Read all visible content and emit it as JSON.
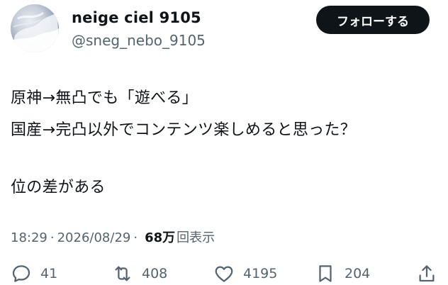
{
  "user": {
    "name": "neige ciel 9105",
    "handle": "@sneg_nebo_9105"
  },
  "follow_button": {
    "label": "フォローする"
  },
  "tweet": {
    "line1": "原神→無凸でも「遊べる」",
    "line2": "国産→完凸以外でコンテンツ楽しめると思った？",
    "line3": "位の差がある"
  },
  "meta": {
    "time": "18:29",
    "date": "2026/08/29",
    "separator": "·",
    "views_count": "68万",
    "views_label": "回表示"
  },
  "actions": {
    "replies": "41",
    "retweets": "408",
    "likes": "4195",
    "bookmarks": "204"
  },
  "icons": {
    "reply": "reply-icon",
    "retweet": "retweet-icon",
    "like": "heart-icon",
    "bookmark": "bookmark-icon",
    "share": "share-icon"
  },
  "colors": {
    "text": "#0f1419",
    "secondary": "#536471",
    "button_bg": "#0f1419",
    "button_text": "#ffffff"
  }
}
